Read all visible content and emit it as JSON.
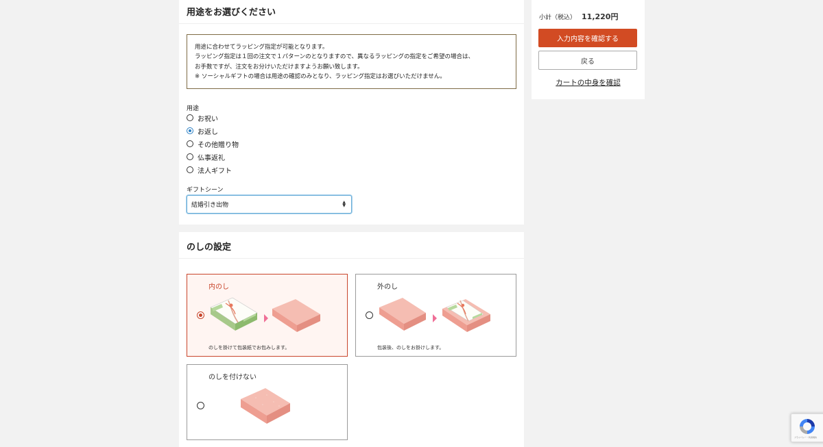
{
  "usage_section": {
    "title": "用途をお選びください",
    "notice_lines": [
      "用途に合わせてラッピング指定が可能となります。",
      "ラッピング指定は１回の注文で１パターンのとなりますので、異なるラッピングの指定をご希望の場合は、",
      "お手数ですが、注文をお分けいただけますようお願い致します。",
      "※ ソーシャルギフトの場合は用途の確認のみとなり、ラッピング指定はお選びいただけません。"
    ],
    "purpose_label": "用途",
    "purpose_options": [
      {
        "label": "お祝い",
        "checked": false
      },
      {
        "label": "お返し",
        "checked": true
      },
      {
        "label": "その他贈り物",
        "checked": false
      },
      {
        "label": "仏事返礼",
        "checked": false
      },
      {
        "label": "法人ギフト",
        "checked": false
      }
    ],
    "scene_label": "ギフトシーン",
    "scene_value": "結婚引き出物"
  },
  "noshi_section": {
    "title": "のしの設定",
    "options": [
      {
        "title": "内のし",
        "desc": "のしを掛けて包装紙でお包みします。",
        "selected": true
      },
      {
        "title": "外のし",
        "desc": "包装後、のしをお掛けします。",
        "selected": false
      },
      {
        "title": "のしを付けない",
        "desc": "",
        "selected": false
      }
    ]
  },
  "sidebar": {
    "subtotal_label": "小計（税込）",
    "subtotal_amount": "11,220円",
    "confirm_button": "入力内容を確認する",
    "back_button": "戻る",
    "cart_link": "カートの中身を確認"
  },
  "recaptcha": {
    "text": "プライバシー・利用規約"
  },
  "colors": {
    "accent": "#d24b23",
    "selected_border": "#c8442a",
    "radio_checked": "#2b7fc4",
    "notice_border": "#7d6a44",
    "box_pink": "#f4b3a8"
  }
}
